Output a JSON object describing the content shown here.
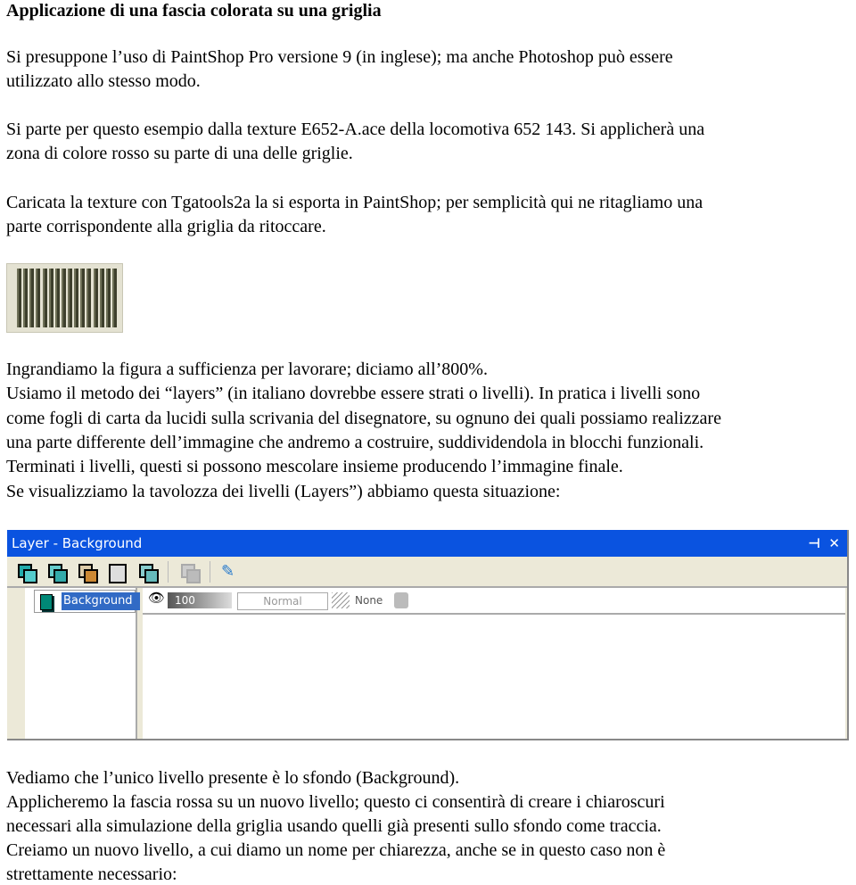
{
  "doc": {
    "title": "Applicazione di una fascia colorata su una griglia",
    "lines": [
      "Si presuppone l’uso di PaintShop Pro versione 9 (in inglese); ma anche Photoshop può essere",
      "utilizzato allo stesso modo.",
      "Si parte per questo esempio dalla texture E652-A.ace della locomotiva 652 143. Si applicherà una",
      "zona di colore rosso su parte di una delle griglie.",
      "Caricata la texture con Tgatools2a la si esporta in PaintShop; per semplicità qui ne ritagliamo una",
      "parte corrispondente alla griglia da ritoccare.",
      "Ingrandiamo la figura a sufficienza per lavorare; diciamo all’800%.",
      "Usiamo il metodo dei “layers” (in italiano dovrebbe essere strati o livelli). In pratica i livelli sono",
      "come fogli di carta da lucidi sulla scrivania del disegnatore, su ognuno dei quali possiamo realizzare",
      "una parte differente dell’immagine che andremo a costruire, suddividendola in blocchi funzionali.",
      "Terminati i livelli, questi si possono mescolare insieme producendo l’immagine finale.",
      "Se visualizziamo la tavolozza dei livelli (Layers”) abbiamo questa situazione:",
      "Vediamo che l’unico livello presente è lo sfondo (Background).",
      "Applicheremo la fascia rossa su un nuovo livello; questo ci consentirà di creare i chiaroscuri",
      "necessari alla simulazione della griglia usando quelli già presenti sullo sfondo come traccia.",
      "Creiamo un nuovo livello, a cui diamo un nome per chiarezza, anche se in questo caso non è",
      "strettamente necessario:"
    ]
  },
  "palette": {
    "title": "Layer - Background",
    "pin": "⊣",
    "close": "✕",
    "layer_name": "Background",
    "opacity": "100",
    "blend_mode": "Normal",
    "mask": "None",
    "eye": "👁",
    "colors": {
      "titlebar": "#0a53e0",
      "selection": "#316ac5"
    }
  }
}
